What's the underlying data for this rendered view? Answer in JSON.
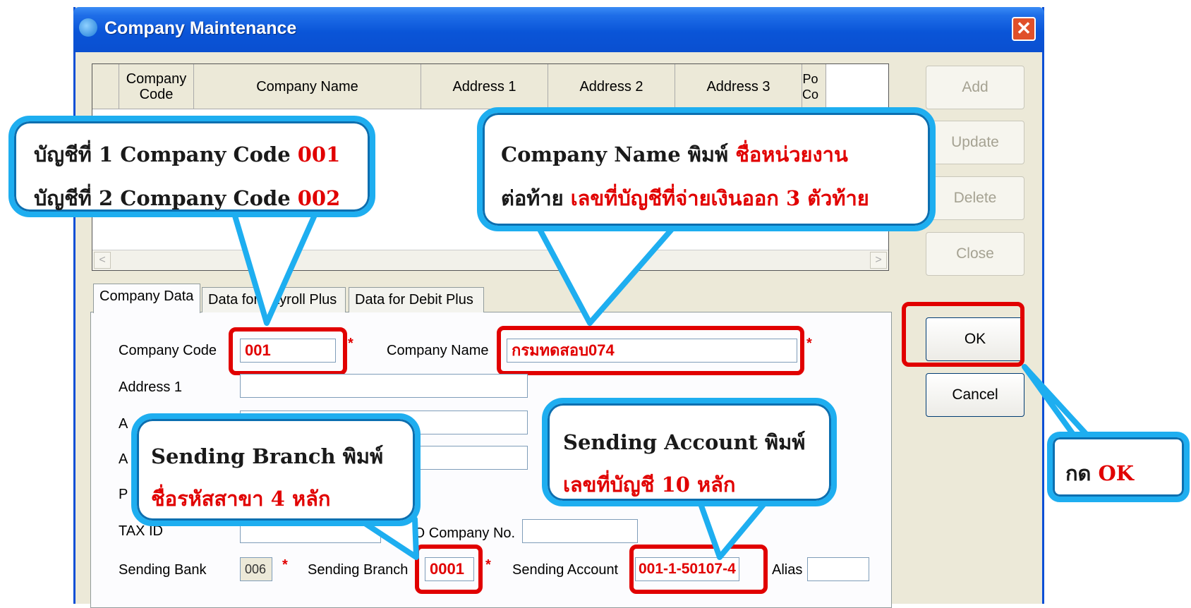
{
  "window": {
    "title": "Company Maintenance",
    "close_label": "✕"
  },
  "grid": {
    "columns": [
      "Company\nCode",
      "Company Name",
      "Address 1",
      "Address 2",
      "Address 3",
      "Po\nCo"
    ],
    "scroll_left": "<",
    "scroll_right": ">"
  },
  "buttons": {
    "add": "Add",
    "update": "Update",
    "delete": "Delete",
    "close": "Close",
    "ok": "OK",
    "cancel": "Cancel"
  },
  "tabs": [
    "Company Data",
    "Data for Payroll Plus",
    "Data for Debit Plus"
  ],
  "form": {
    "company_code_label": "Company Code",
    "company_code_value": "001",
    "company_name_label": "Company Name",
    "company_name_value": "กรมทดสอบ074",
    "address1_label": "Address 1",
    "address2_label": "A",
    "address3_label": "A",
    "postcode_label": "P",
    "taxid_label": "TAX ID",
    "sso_label": "SSO Company No.",
    "sending_bank_label": "Sending Bank",
    "sending_bank_value": "006",
    "sending_branch_label": "Sending Branch",
    "sending_branch_value": "0001",
    "sending_account_label": "Sending Account",
    "sending_account_value": "001-1-50107-4",
    "alias_label": "Alias",
    "required_mark": "*"
  },
  "callouts": {
    "code": {
      "line1": "บัญชีที่ 1 Company Code ",
      "line1_red": "001",
      "line2": "บัญชีที่ 2 Company Code ",
      "line2_red": "002"
    },
    "name": {
      "line1": "Company Name พิมพ์ ",
      "line1_red": "ชื่อหน่วยงาน",
      "line2": "ต่อท้าย ",
      "line2_red": "เลขที่บัญชีที่จ่ายเงินออก 3 ตัวท้าย"
    },
    "branch": {
      "line1": "Sending Branch พิมพ์",
      "line2_red": "ชื่อรหัสสาขา 4 หลัก"
    },
    "account": {
      "line1": "Sending Account พิมพ์",
      "line2_red": "เลขที่บัญชี 10 หลัก"
    },
    "ok": {
      "line1": "กด ",
      "line1_red": "OK"
    }
  },
  "colors": {
    "title_bar": "#0a55d8",
    "callout_border": "#1eaef0",
    "highlight": "#e10000"
  }
}
